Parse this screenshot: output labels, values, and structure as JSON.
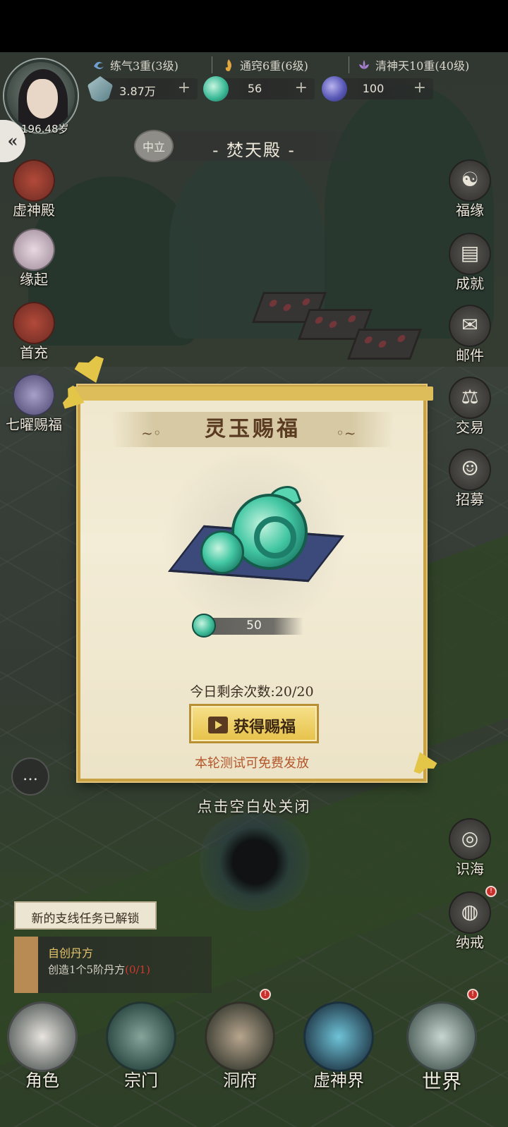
{
  "header": {
    "stats": [
      {
        "label": "练气3重(3级)",
        "icon": "qi-swirl-icon"
      },
      {
        "label": "通窍6重(6级)",
        "icon": "flame-icon"
      },
      {
        "label": "清神天10重(40级)",
        "icon": "lotus-icon"
      }
    ],
    "currencies": [
      {
        "value": "3.87万",
        "plus": "+",
        "icon": "spirit-stone-icon"
      },
      {
        "value": "56",
        "plus": "+",
        "icon": "jade-icon"
      },
      {
        "value": "100",
        "plus": "+",
        "icon": "blue-orb-icon"
      }
    ],
    "age": "196.48岁",
    "toggle": "«",
    "location_seal": "中立",
    "location_name": "- 焚天殿 -"
  },
  "left_menu": [
    {
      "label": "虚神殿"
    },
    {
      "label": "缘起"
    },
    {
      "label": "首充"
    },
    {
      "label": "七曜赐福"
    }
  ],
  "right_menu": [
    {
      "label": "福缘",
      "glyph": "☯"
    },
    {
      "label": "成就",
      "glyph": "▤"
    },
    {
      "label": "邮件",
      "glyph": "✉"
    },
    {
      "label": "交易",
      "glyph": "⚖"
    },
    {
      "label": "招募",
      "glyph": "☺"
    },
    {
      "label": "识海",
      "glyph": "◎"
    },
    {
      "label": "纳戒",
      "glyph": "◍",
      "badge": "!"
    }
  ],
  "chat": {
    "icon": "chat-bubble-icon",
    "glyph": "…"
  },
  "modal": {
    "title": "灵玉赐福",
    "reward_count": "50",
    "remaining": "今日剩余次数:20/20",
    "button_label": "获得赐福",
    "note": "本轮测试可免费发放"
  },
  "close_hint": "点击空白处关闭",
  "toast": "新的支线任务已解锁",
  "quest": {
    "title": "自创丹方",
    "desc": "创造1个5阶丹方",
    "progress": "(0/1)"
  },
  "bottom_nav": [
    {
      "label": "角色"
    },
    {
      "label": "宗门"
    },
    {
      "label": "洞府",
      "badge": "!"
    },
    {
      "label": "虚神界"
    },
    {
      "label": "世界",
      "badge": "!"
    }
  ]
}
